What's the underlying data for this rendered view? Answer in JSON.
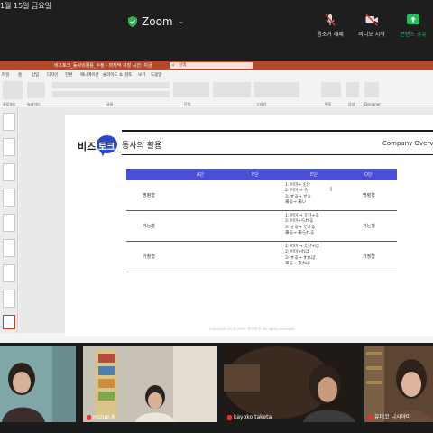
{
  "topbar": {
    "date": "1월 15일 금요일",
    "app_title": "Zoom",
    "mute_label": "음소거 해제",
    "video_label": "비디오 시작",
    "share_label": "콘텐츠 공유",
    "share_color": "#1fbf5c"
  },
  "ppt": {
    "window_title": "비즈토크_동사의활용_수정 - 마지막 저장 시간: 지금",
    "search_placeholder": "검색",
    "tabs": [
      "파일",
      "홈",
      "삽입",
      "디자인",
      "전환",
      "애니메이션",
      "슬라이드 쇼",
      "검토",
      "보기",
      "도움말"
    ],
    "groups": [
      "클립보드",
      "슬라이드",
      "글꼴",
      "단락",
      "그리기",
      "편집",
      "음성",
      "Designer"
    ],
    "accent": "#b7472a"
  },
  "slide": {
    "logo_left": "비즈",
    "logo_right": "토크",
    "title": "동사의 활용",
    "company": "Company Overview",
    "table": {
      "headers": [
        "A단",
        "E단",
        "E단",
        "O단"
      ],
      "rows": [
        {
          "name": "명령형",
          "forms": "1: 어미→ え단\n2: 어미 → ろ\n3: する→ せよ\n来る→ 来い",
          "result": "명령형"
        },
        {
          "name": "가능형",
          "forms": "1: 어미 → え단+る\n2: 어미+られる\n3: する→ できる\n来る→ 来られる",
          "result": "가능형"
        },
        {
          "name": "가정형",
          "forms": "1: 어미 → え단+ば\n2: 어미+れば\n3: する→ すれば\n来る→ 来れば",
          "result": "가정형"
        }
      ]
    },
    "copyright": "Copyright 2018-2019. 비즈토크. All rights reserved."
  },
  "gallery": {
    "participants": [
      {
        "name": ""
      },
      {
        "name": "mizue A"
      },
      {
        "name": "kayoko taketa"
      },
      {
        "name": "유미코 니시야마"
      }
    ]
  }
}
